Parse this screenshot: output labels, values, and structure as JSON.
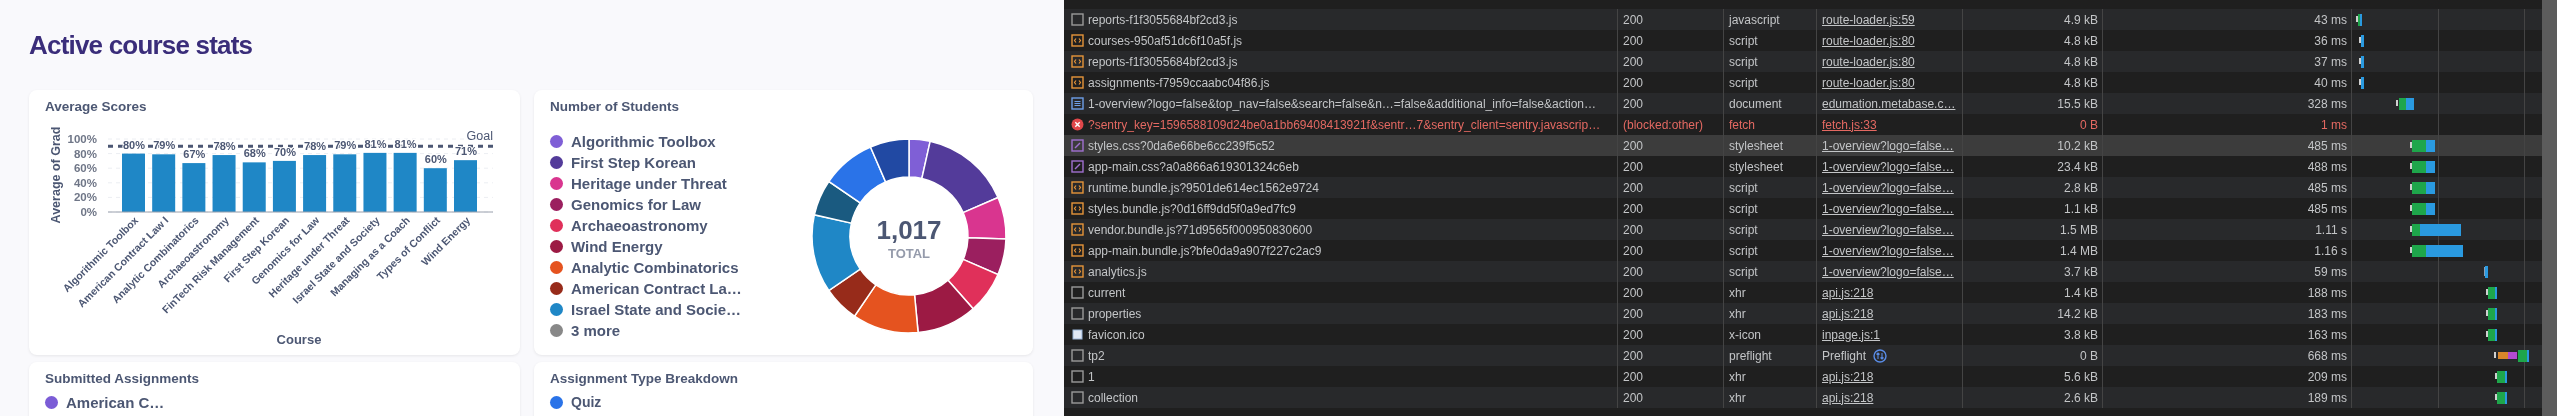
{
  "dashboard": {
    "title": "Active course stats",
    "average_scores": {
      "chart_data": {
        "type": "bar",
        "title": "Average Scores",
        "xlabel": "Course",
        "ylabel": "Average of Grad",
        "categories": [
          "Algorithmic Toolbox",
          "American Contract Law I",
          "Analytic Combinatorics",
          "Archaeoastronomy",
          "FinTech Risk Management",
          "First Step Korean",
          "Genomics for Law",
          "Heritage under Threat",
          "Israel State and Society",
          "Managing as a Coach",
          "Types of Conflict",
          "Wind Energy"
        ],
        "values": [
          80,
          79,
          67,
          78,
          68,
          70,
          78,
          79,
          81,
          81,
          60,
          71
        ],
        "grid": true,
        "value_labels": [
          "80%",
          "79%",
          "67%",
          "78%",
          "68%",
          "70%",
          "78%",
          "79%",
          "81%",
          "81%",
          "60%",
          "71%"
        ],
        "ylim": [
          0,
          100
        ],
        "yticks": [
          {
            "value": 0,
            "label": "0%"
          },
          {
            "value": 20,
            "label": "20%"
          },
          {
            "value": 40,
            "label": "40%"
          },
          {
            "value": 60,
            "label": "60%"
          },
          {
            "value": 80,
            "label": "80%"
          },
          {
            "value": 100,
            "label": "100%"
          }
        ],
        "ref_lines": [
          {
            "axis": "y",
            "value": 90,
            "label": "Goal"
          }
        ]
      }
    },
    "students": {
      "title": "Number of Students",
      "total": "1,017",
      "total_label": "TOTAL",
      "legend": [
        {
          "label": "Algorithmic Toolbox",
          "color": "#7f5fd6",
          "kind": "course"
        },
        {
          "label": "First Step Korean",
          "color": "#533b9a",
          "kind": "course"
        },
        {
          "label": "Heritage under Threat",
          "color": "#d9358f",
          "kind": "course"
        },
        {
          "label": "Genomics for Law",
          "color": "#9b1f5f",
          "kind": "course"
        },
        {
          "label": "Archaeoastronomy",
          "color": "#e0305a",
          "kind": "course"
        },
        {
          "label": "Wind Energy",
          "color": "#9c1a44",
          "kind": "course"
        },
        {
          "label": "Analytic Combinatorics",
          "color": "#e5531f",
          "kind": "course"
        },
        {
          "label": "American Contract La…",
          "color": "#972b1a",
          "kind": "course"
        },
        {
          "label": "Israel State and Socie…",
          "color": "#1f87c6",
          "kind": "course"
        },
        {
          "label": "3 more",
          "color": "#888888",
          "kind": "more"
        }
      ]
    },
    "submitted": {
      "title": "Submitted Assignments",
      "legend": [
        {
          "label": "American C…",
          "color": "#7b5cd6"
        }
      ]
    },
    "breakdown": {
      "title": "Assignment Type Breakdown",
      "legend": [
        {
          "label": "Quiz",
          "color": "#2a73e8"
        }
      ]
    }
  },
  "network": {
    "requests": [
      {
        "name": "reports-f1f3055684bf2cd3.js",
        "status": "200",
        "type": "javascript",
        "initiator": "route-loader.js:59",
        "initiator_link": true,
        "size": "4.9 kB",
        "time": "43 ms",
        "kind": "blank",
        "selected": false
      },
      {
        "name": "courses-950af51dc6f10a5f.js",
        "status": "200",
        "type": "script",
        "initiator": "route-loader.js:80",
        "initiator_link": true,
        "size": "4.8 kB",
        "time": "36 ms",
        "kind": "script",
        "selected": false
      },
      {
        "name": "reports-f1f3055684bf2cd3.js",
        "status": "200",
        "type": "script",
        "initiator": "route-loader.js:80",
        "initiator_link": true,
        "size": "4.8 kB",
        "time": "37 ms",
        "kind": "script",
        "selected": false
      },
      {
        "name": "assignments-f7959ccaabc04f86.js",
        "status": "200",
        "type": "script",
        "initiator": "route-loader.js:80",
        "initiator_link": true,
        "size": "4.8 kB",
        "time": "40 ms",
        "kind": "script",
        "selected": false
      },
      {
        "name": "1-overview?logo=false&top_nav=false&search=false&n…=false&additional_info=false&action…",
        "status": "200",
        "type": "document",
        "initiator": "edumation.metabase.c…",
        "initiator_link": true,
        "size": "15.5 kB",
        "time": "328 ms",
        "kind": "document",
        "selected": false
      },
      {
        "name": "?sentry_key=1596588109d24be0a1bb69408413921f&sentr…7&sentry_client=sentry.javascrip…",
        "status": "(blocked:other)",
        "type": "fetch",
        "initiator": "fetch.js:33",
        "initiator_link": true,
        "size": "0 B",
        "time": "1 ms",
        "kind": "error",
        "selected": false
      },
      {
        "name": "styles.css?0da6e66be6cc239f5c52",
        "status": "200",
        "type": "stylesheet",
        "initiator": "1-overview?logo=false…",
        "initiator_link": true,
        "size": "10.2 kB",
        "time": "485 ms",
        "kind": "stylesheet",
        "selected": true
      },
      {
        "name": "app-main.css?a0a866a619301324c6eb",
        "status": "200",
        "type": "stylesheet",
        "initiator": "1-overview?logo=false…",
        "initiator_link": true,
        "size": "23.4 kB",
        "time": "488 ms",
        "kind": "stylesheet",
        "selected": false
      },
      {
        "name": "runtime.bundle.js?9501de614ec1562e9724",
        "status": "200",
        "type": "script",
        "initiator": "1-overview?logo=false…",
        "initiator_link": true,
        "size": "2.8 kB",
        "time": "485 ms",
        "kind": "script",
        "selected": false
      },
      {
        "name": "styles.bundle.js?0d16ff9dd5f0a9ed7fc9",
        "status": "200",
        "type": "script",
        "initiator": "1-overview?logo=false…",
        "initiator_link": true,
        "size": "1.1 kB",
        "time": "485 ms",
        "kind": "script",
        "selected": false
      },
      {
        "name": "vendor.bundle.js?71d9565f000950830600",
        "status": "200",
        "type": "script",
        "initiator": "1-overview?logo=false…",
        "initiator_link": true,
        "size": "1.5 MB",
        "time": "1.11 s",
        "kind": "script",
        "selected": false
      },
      {
        "name": "app-main.bundle.js?bfe0da9a907f227c2ac9",
        "status": "200",
        "type": "script",
        "initiator": "1-overview?logo=false…",
        "initiator_link": true,
        "size": "1.4 MB",
        "time": "1.16 s",
        "kind": "script",
        "selected": false
      },
      {
        "name": "analytics.js",
        "status": "200",
        "type": "script",
        "initiator": "1-overview?logo=false…",
        "initiator_link": true,
        "size": "3.7 kB",
        "time": "59 ms",
        "kind": "script",
        "selected": false
      },
      {
        "name": "current",
        "status": "200",
        "type": "xhr",
        "initiator": "api.js:218",
        "initiator_link": true,
        "size": "1.4 kB",
        "time": "188 ms",
        "kind": "blank",
        "selected": false
      },
      {
        "name": "properties",
        "status": "200",
        "type": "xhr",
        "initiator": "api.js:218",
        "initiator_link": true,
        "size": "14.2 kB",
        "time": "183 ms",
        "kind": "blank",
        "selected": false
      },
      {
        "name": "favicon.ico",
        "status": "200",
        "type": "x-icon",
        "initiator": "inpage.js:1",
        "initiator_link": true,
        "size": "3.8 kB",
        "time": "163 ms",
        "kind": "image",
        "selected": false
      },
      {
        "name": "tp2",
        "status": "200",
        "type": "preflight",
        "initiator": "Preflight",
        "initiator_link": false,
        "size": "0 B",
        "time": "668 ms",
        "kind": "blank",
        "selected": false
      },
      {
        "name": "1",
        "status": "200",
        "type": "xhr",
        "initiator": "api.js:218",
        "initiator_link": true,
        "size": "5.6 kB",
        "time": "209 ms",
        "kind": "blank",
        "selected": false
      },
      {
        "name": "collection",
        "status": "200",
        "type": "xhr",
        "initiator": "api.js:218",
        "initiator_link": true,
        "size": "2.6 kB",
        "time": "189 ms",
        "kind": "blank",
        "selected": false
      }
    ]
  }
}
